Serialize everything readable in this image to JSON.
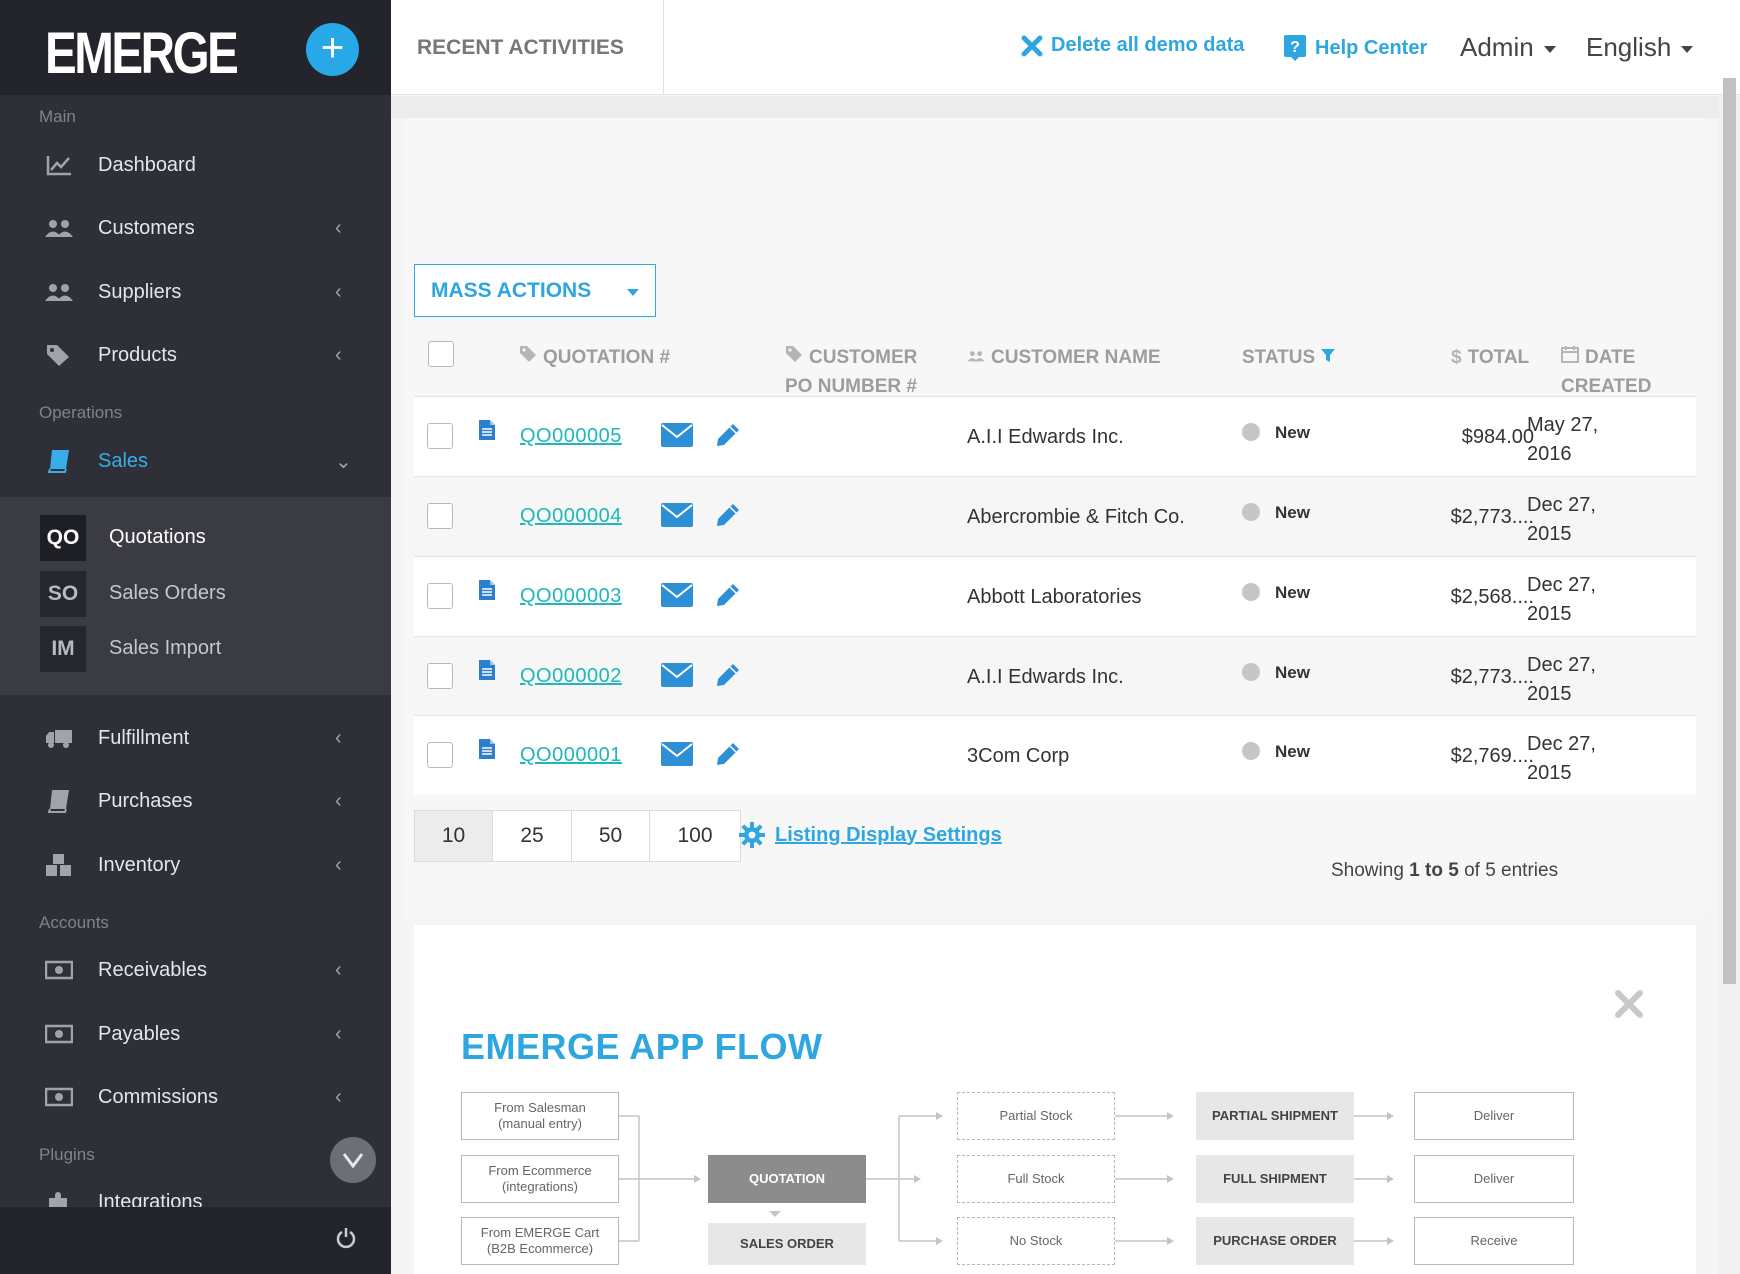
{
  "sidebar": {
    "logo": "EMERGE",
    "add_label": "+",
    "sections": {
      "main": "Main",
      "operations": "Operations",
      "accounts": "Accounts",
      "plugins": "Plugins"
    },
    "items": {
      "dashboard": "Dashboard",
      "customers": "Customers",
      "suppliers": "Suppliers",
      "products": "Products",
      "sales": "Sales",
      "fulfillment": "Fulfillment",
      "purchases": "Purchases",
      "inventory": "Inventory",
      "receivables": "Receivables",
      "payables": "Payables",
      "commissions": "Commissions",
      "integrations": "Integrations"
    },
    "sales_sub": [
      {
        "badge": "QO",
        "label": "Quotations"
      },
      {
        "badge": "SO",
        "label": "Sales Orders"
      },
      {
        "badge": "IM",
        "label": "Sales Import"
      }
    ]
  },
  "topbar": {
    "page_title": "RECENT ACTIVITIES",
    "delete_demo": "Delete all demo data",
    "help_center": "Help Center",
    "user_menu": "Admin",
    "language": "English"
  },
  "table": {
    "mass_actions": "MASS ACTIONS",
    "headers": {
      "quotation": "QUOTATION #",
      "po_line1": "CUSTOMER",
      "po_line2": "PO NUMBER #",
      "customer_name": "CUSTOMER NAME",
      "status": "STATUS",
      "total": "TOTAL",
      "date_line1": "DATE",
      "date_line2": "CREATED"
    },
    "rows": [
      {
        "id": "QO000005",
        "customer": "A.I.I Edwards Inc.",
        "status": "New",
        "total": "$984.00",
        "date1": "May 27,",
        "date2": "2016"
      },
      {
        "id": "QO000004",
        "customer": "Abercrombie & Fitch Co.",
        "status": "New",
        "total": "$2,773....",
        "date1": "Dec 27,",
        "date2": "2015"
      },
      {
        "id": "QO000003",
        "customer": "Abbott Laboratories",
        "status": "New",
        "total": "$2,568....",
        "date1": "Dec 27,",
        "date2": "2015"
      },
      {
        "id": "QO000002",
        "customer": "A.I.I Edwards Inc.",
        "status": "New",
        "total": "$2,773....",
        "date1": "Dec 27,",
        "date2": "2015"
      },
      {
        "id": "QO000001",
        "customer": "3Com Corp",
        "status": "New",
        "total": "$2,769....",
        "date1": "Dec 27,",
        "date2": "2015"
      }
    ],
    "page_sizes": [
      "10",
      "25",
      "50",
      "100"
    ],
    "active_page_size": "10",
    "listing_settings": "Listing Display Settings",
    "showing_prefix": "Showing ",
    "showing_range": "1 to 5",
    "showing_suffix": " of 5 entries"
  },
  "flow": {
    "title": "EMERGE APP FLOW",
    "sources": [
      "From Salesman\n(manual entry)",
      "From Ecommerce\n(integrations)",
      "From EMERGE Cart\n(B2B Ecommerce)"
    ],
    "quotation": "QUOTATION",
    "sales_order": "SALES ORDER",
    "stock": [
      "Partial Stock",
      "Full Stock",
      "No Stock"
    ],
    "actions": [
      "PARTIAL SHIPMENT",
      "FULL SHIPMENT",
      "PURCHASE ORDER"
    ],
    "results": [
      "Deliver",
      "Deliver",
      "Receive"
    ]
  },
  "colors": {
    "accent": "#2ea6e0",
    "link": "#1fb7b9",
    "sidebar": "#2e2f37"
  }
}
